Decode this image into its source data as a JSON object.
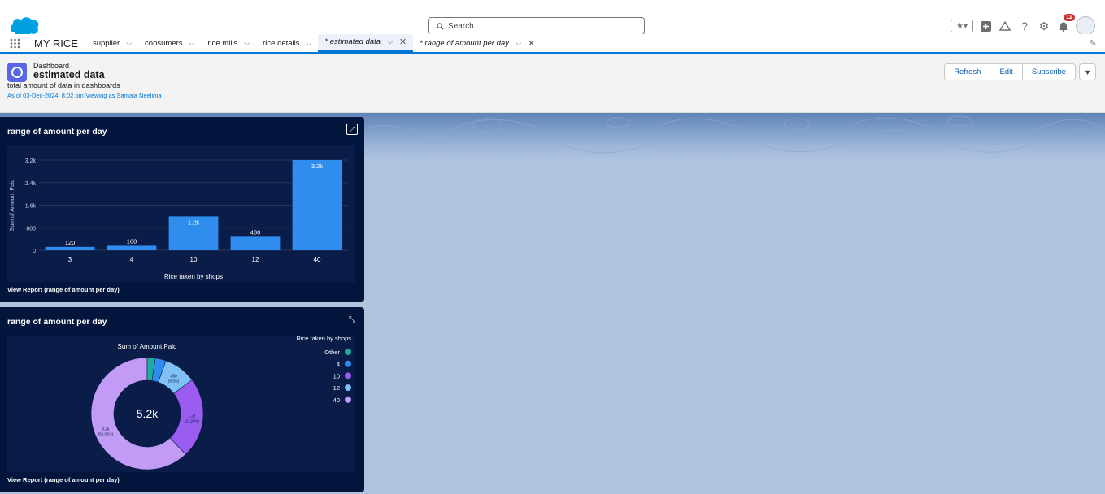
{
  "header": {
    "search_placeholder": "Search...",
    "notification_count": "12",
    "icons": [
      "favorites-star-icon",
      "add-icon",
      "trailhead-icon",
      "help-icon",
      "gear-icon",
      "bell-icon",
      "avatar"
    ]
  },
  "nav": {
    "app_name": "MY RICE",
    "tabs": [
      {
        "label": "supplier"
      },
      {
        "label": "consumers"
      },
      {
        "label": "rice mills"
      },
      {
        "label": "rice details"
      },
      {
        "label": "* estimated data",
        "active": true
      },
      {
        "label": "* range of amount per day"
      }
    ]
  },
  "dashboard": {
    "type_label": "Dashboard",
    "title": "estimated data",
    "description": "total amount of data in dashboards",
    "as_of": "As of 03-Dec-2024, 8:02 pm·Viewing as Samala Neelima",
    "buttons": {
      "refresh": "Refresh",
      "edit": "Edit",
      "subscribe": "Subscribe"
    }
  },
  "widgets": [
    {
      "title": "range of amount per day",
      "view_report": "View Report (range of amount per day)"
    },
    {
      "title": "range of amount per day",
      "view_report": "View Report (range of amount per day)"
    }
  ],
  "colors": {
    "accent": "#0176d3",
    "widget_bg": "#02163d",
    "bar": "#2f8eed"
  },
  "chart_data": [
    {
      "type": "bar",
      "categories": [
        "3",
        "4",
        "10",
        "12",
        "40"
      ],
      "values": [
        120,
        160,
        1200,
        480,
        3200
      ],
      "data_labels": [
        "120",
        "160",
        "1.2k",
        "480",
        "3.2k"
      ],
      "xlabel": "Rice taken by shops",
      "ylabel": "Sum of Amount Paid",
      "yticks": [
        "0",
        "800",
        "1.6k",
        "2.4k",
        "3.2k"
      ],
      "ylim": [
        0,
        3200
      ]
    },
    {
      "type": "pie",
      "title": "Sum of Amount Paid",
      "center_label": "5.2k",
      "legend_title": "Rice taken by shops",
      "legend_placement": "top-right",
      "slices": [
        {
          "name": "40",
          "value": 3200,
          "label": "3.2k",
          "pct": "(62.02%)",
          "color": "#c19bf5"
        },
        {
          "name": "Other",
          "value": 120,
          "label": "",
          "pct": "",
          "color": "#1fae9e"
        },
        {
          "name": "4",
          "value": 160,
          "label": "",
          "pct": "",
          "color": "#2f8eed"
        },
        {
          "name": "12",
          "value": 480,
          "label": "480",
          "pct": "(9.3%)",
          "color": "#7fc0f5"
        },
        {
          "name": "10",
          "value": 1200,
          "label": "1.2k",
          "pct": "(23.26%)",
          "color": "#9b5cf0"
        }
      ],
      "legend": [
        {
          "name": "Other",
          "color": "#1fae9e"
        },
        {
          "name": "4",
          "color": "#2f8eed"
        },
        {
          "name": "10",
          "color": "#9b5cf0"
        },
        {
          "name": "12",
          "color": "#7fc0f5"
        },
        {
          "name": "40",
          "color": "#c19bf5"
        }
      ]
    }
  ]
}
